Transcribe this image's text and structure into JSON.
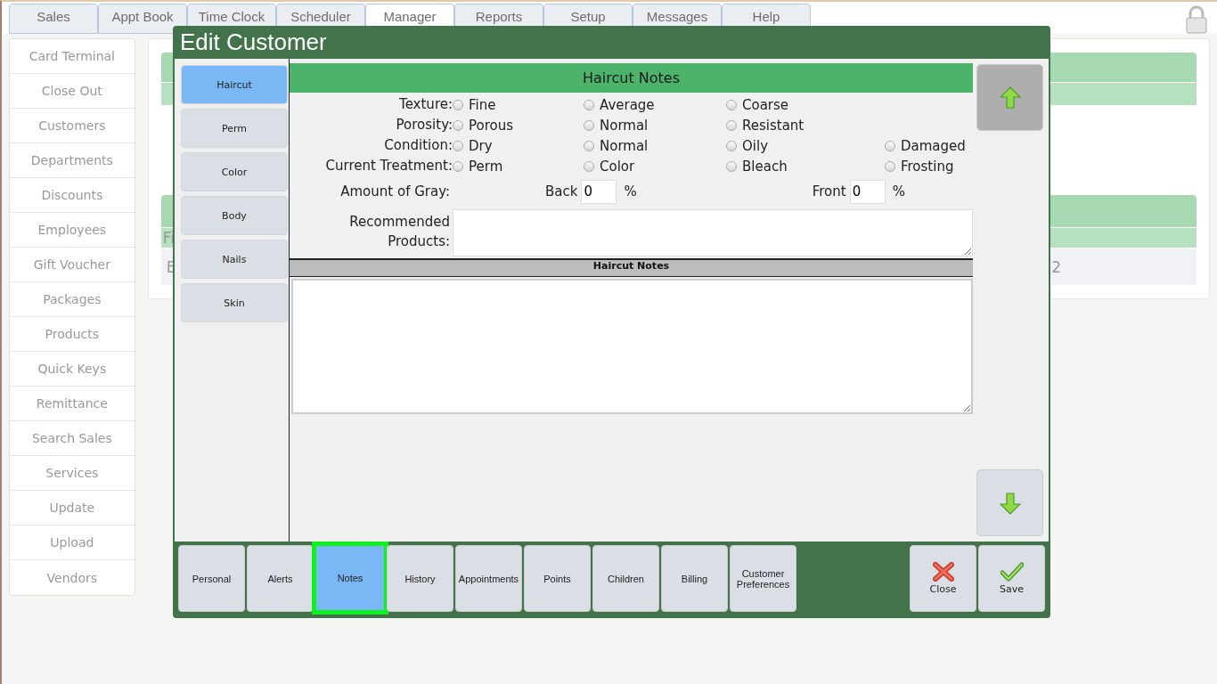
{
  "top_tabs": [
    {
      "label": "Sales",
      "selected": false
    },
    {
      "label": "Appt Book",
      "selected": false
    },
    {
      "label": "Time Clock",
      "selected": false
    },
    {
      "label": "Scheduler",
      "selected": false
    },
    {
      "label": "Manager",
      "selected": true
    },
    {
      "label": "Reports",
      "selected": false
    },
    {
      "label": "Setup",
      "selected": false
    },
    {
      "label": "Messages",
      "selected": false
    },
    {
      "label": "Help",
      "selected": false
    }
  ],
  "sidebar": {
    "items": [
      "Card Terminal",
      "Close Out",
      "Customers",
      "Departments",
      "Discounts",
      "Employees",
      "Gift Voucher",
      "Packages",
      "Products",
      "Quick Keys",
      "Remittance",
      "Search Sales",
      "Services",
      "Update",
      "Upload",
      "Vendors"
    ]
  },
  "background_table": {
    "header_fragment": "Fi",
    "row_fragment_start": "E",
    "row_fragment_end": "2"
  },
  "dialog": {
    "title": "Edit Customer",
    "categories": [
      {
        "label": "Haircut",
        "selected": true
      },
      {
        "label": "Perm",
        "selected": false
      },
      {
        "label": "Color",
        "selected": false
      },
      {
        "label": "Body",
        "selected": false
      },
      {
        "label": "Nails",
        "selected": false
      },
      {
        "label": "Skin",
        "selected": false
      }
    ],
    "section_title": "Haircut Notes",
    "radio_groups": [
      {
        "label": "Texture:",
        "options": [
          {
            "label": "Fine",
            "selected": false
          },
          {
            "label": "Average",
            "selected": false
          },
          {
            "label": "Coarse",
            "selected": false
          }
        ]
      },
      {
        "label": "Porosity:",
        "options": [
          {
            "label": "Porous",
            "selected": false
          },
          {
            "label": "Normal",
            "selected": false
          },
          {
            "label": "Resistant",
            "selected": false
          }
        ]
      },
      {
        "label": "Condition:",
        "options": [
          {
            "label": "Dry",
            "selected": false
          },
          {
            "label": "Normal",
            "selected": false
          },
          {
            "label": "Oily",
            "selected": false
          },
          {
            "label": "Damaged",
            "selected": false
          }
        ]
      },
      {
        "label": "Current Treatment:",
        "options": [
          {
            "label": "Perm",
            "selected": false
          },
          {
            "label": "Color",
            "selected": false
          },
          {
            "label": "Bleach",
            "selected": false
          },
          {
            "label": "Frosting",
            "selected": false
          }
        ]
      }
    ],
    "gray": {
      "label": "Amount of Gray:",
      "back_label": "Back",
      "back_value": "0",
      "front_label": "Front",
      "front_value": "0",
      "unit": "%"
    },
    "recommended_label": "Recommended Products:",
    "notes_title": "Haircut Notes",
    "scroll_buttons": [
      {
        "kind": "up"
      },
      {
        "kind": "down"
      }
    ],
    "bottom_tabs": [
      {
        "label": "Personal",
        "selected": false
      },
      {
        "label": "Alerts",
        "selected": false
      },
      {
        "label": "Notes",
        "selected": true
      },
      {
        "label": "History",
        "selected": false
      },
      {
        "label": "Appointments",
        "selected": false
      },
      {
        "label": "Points",
        "selected": false
      },
      {
        "label": "Children",
        "selected": false
      },
      {
        "label": "Billing",
        "selected": false
      },
      {
        "label": "Customer Preferences",
        "selected": false
      }
    ],
    "actions": [
      {
        "label": "Close",
        "kind": "close"
      },
      {
        "label": "Save",
        "kind": "save"
      }
    ]
  }
}
